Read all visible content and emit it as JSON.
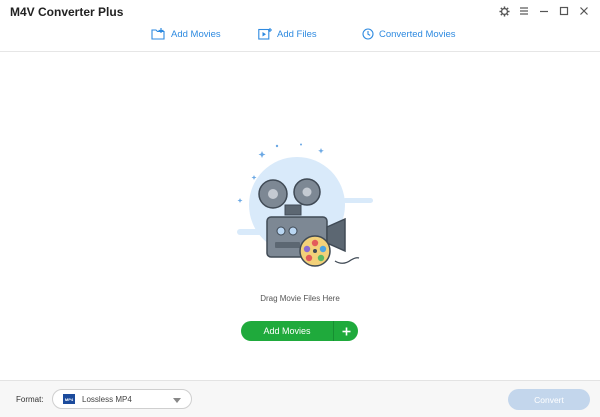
{
  "app": {
    "title": "M4V Converter Plus"
  },
  "window_controls": [
    {
      "name": "settings",
      "icon": "gear-icon"
    },
    {
      "name": "menu",
      "icon": "menu-icon"
    },
    {
      "name": "minimize",
      "icon": "minimize-icon"
    },
    {
      "name": "maximize",
      "icon": "maximize-icon"
    },
    {
      "name": "close",
      "icon": "close-icon"
    }
  ],
  "toolbar": {
    "add_movies": "Add Movies",
    "add_files": "Add Files",
    "converted_movies": "Converted Movies"
  },
  "dropzone": {
    "hint": "Drag Movie Files Here",
    "add_button_label": "Add Movies"
  },
  "footer": {
    "format_label": "Format:",
    "format_badge": "MP4",
    "format_value": "Lossless MP4",
    "convert_label": "Convert"
  },
  "colors": {
    "accent_blue": "#2e8ae0",
    "add_green": "#1faa3c",
    "convert_disabled": "#c3d6ec"
  }
}
